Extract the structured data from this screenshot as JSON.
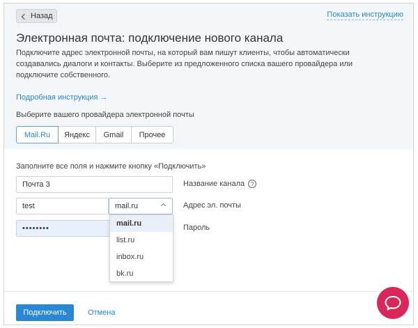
{
  "header": {
    "back_label": "Назад",
    "show_instruction_label": "Показать инструкцию",
    "title": "Электронная почта: подключение нового канала",
    "description": "Подключите адрес электронной почты, на который вам пишут клиенты, чтобы автоматически создавались диалоги и контакты. Выберите из предложенного списка вашего провайдера или подключите собственного.",
    "detailed_instruction_link": "Подробная инструкция →",
    "choose_provider_label": "Выберите вашего провайдера электронной почты"
  },
  "providers": [
    {
      "label": "Mail.Ru",
      "active": true
    },
    {
      "label": "Яндекс",
      "active": false
    },
    {
      "label": "Gmail",
      "active": false
    },
    {
      "label": "Прочее",
      "active": false
    }
  ],
  "form": {
    "instruction": "Заполните все поля и нажмите кнопку «Подключить»",
    "channel_name_value": "Почта 3",
    "channel_name_label": "Название канала",
    "email_local_value": "test",
    "email_domain_value": "mail.ru",
    "email_label": "Адрес эл. почты",
    "password_value": "••••••••",
    "password_label": "Пароль"
  },
  "domain_dropdown": {
    "options": [
      "mail.ru",
      "list.ru",
      "inbox.ru",
      "bk.ru"
    ],
    "selected": "mail.ru"
  },
  "footer": {
    "connect_label": "Подключить",
    "cancel_label": "Отмена"
  },
  "colors": {
    "accent": "#2a87d4",
    "chat_fab": "#d9275a",
    "header_bg": "#f3f6f9"
  },
  "icons": {
    "back": "chevron-left-icon",
    "help": "question-circle-icon",
    "dropdown": "chevron-down-icon",
    "chat": "chat-bubble-icon"
  }
}
